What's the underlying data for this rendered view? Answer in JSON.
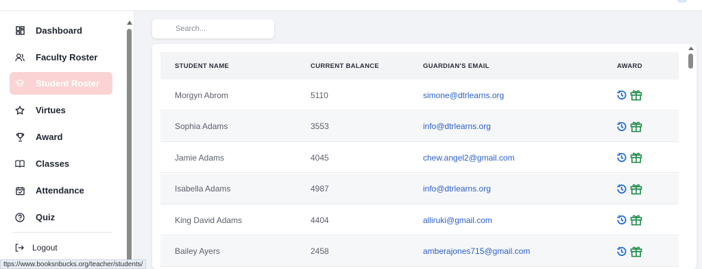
{
  "sidebar": {
    "items": [
      {
        "label": "Dashboard",
        "icon": "dashboard-icon",
        "active": false
      },
      {
        "label": "Faculty Roster",
        "icon": "users-icon",
        "active": false
      },
      {
        "label": "Student Roster",
        "icon": "graduation-cap-icon",
        "active": true
      },
      {
        "label": "Virtues",
        "icon": "star-icon",
        "active": false
      },
      {
        "label": "Award",
        "icon": "trophy-icon",
        "active": false
      },
      {
        "label": "Classes",
        "icon": "book-icon",
        "active": false
      },
      {
        "label": "Attendance",
        "icon": "calendar-check-icon",
        "active": false
      },
      {
        "label": "Quiz",
        "icon": "question-circle-icon",
        "active": false
      }
    ],
    "logout_label": "Logout"
  },
  "search": {
    "placeholder": "Search..."
  },
  "table": {
    "headers": [
      "STUDENT NAME",
      "CURRENT BALANCE",
      "GUARDIAN'S EMAIL",
      "AWARD"
    ],
    "rows": [
      {
        "name": "Morgyn Abrom",
        "balance": "5110",
        "email": "simone@dtrlearns.org"
      },
      {
        "name": "Sophia Adams",
        "balance": "3553",
        "email": "info@dtrlearns.org"
      },
      {
        "name": "Jamie Adams",
        "balance": "4045",
        "email": "chew.angel2@gmail.com"
      },
      {
        "name": "Isabella Adams",
        "balance": "4987",
        "email": "info@dtrlearns.org"
      },
      {
        "name": "King David Adams",
        "balance": "4404",
        "email": "alliruki@gmail.com"
      },
      {
        "name": "Bailey Ayers",
        "balance": "2458",
        "email": "amberajones715@gmail.com"
      }
    ]
  },
  "status_url": "ttps://www.booksnbucks.org/teacher/students/",
  "colors": {
    "active_bg": "#fbd3d4",
    "link": "#2a5fc9",
    "history_icon": "#2a6fd6",
    "gift_icon": "#1e8a4a"
  }
}
